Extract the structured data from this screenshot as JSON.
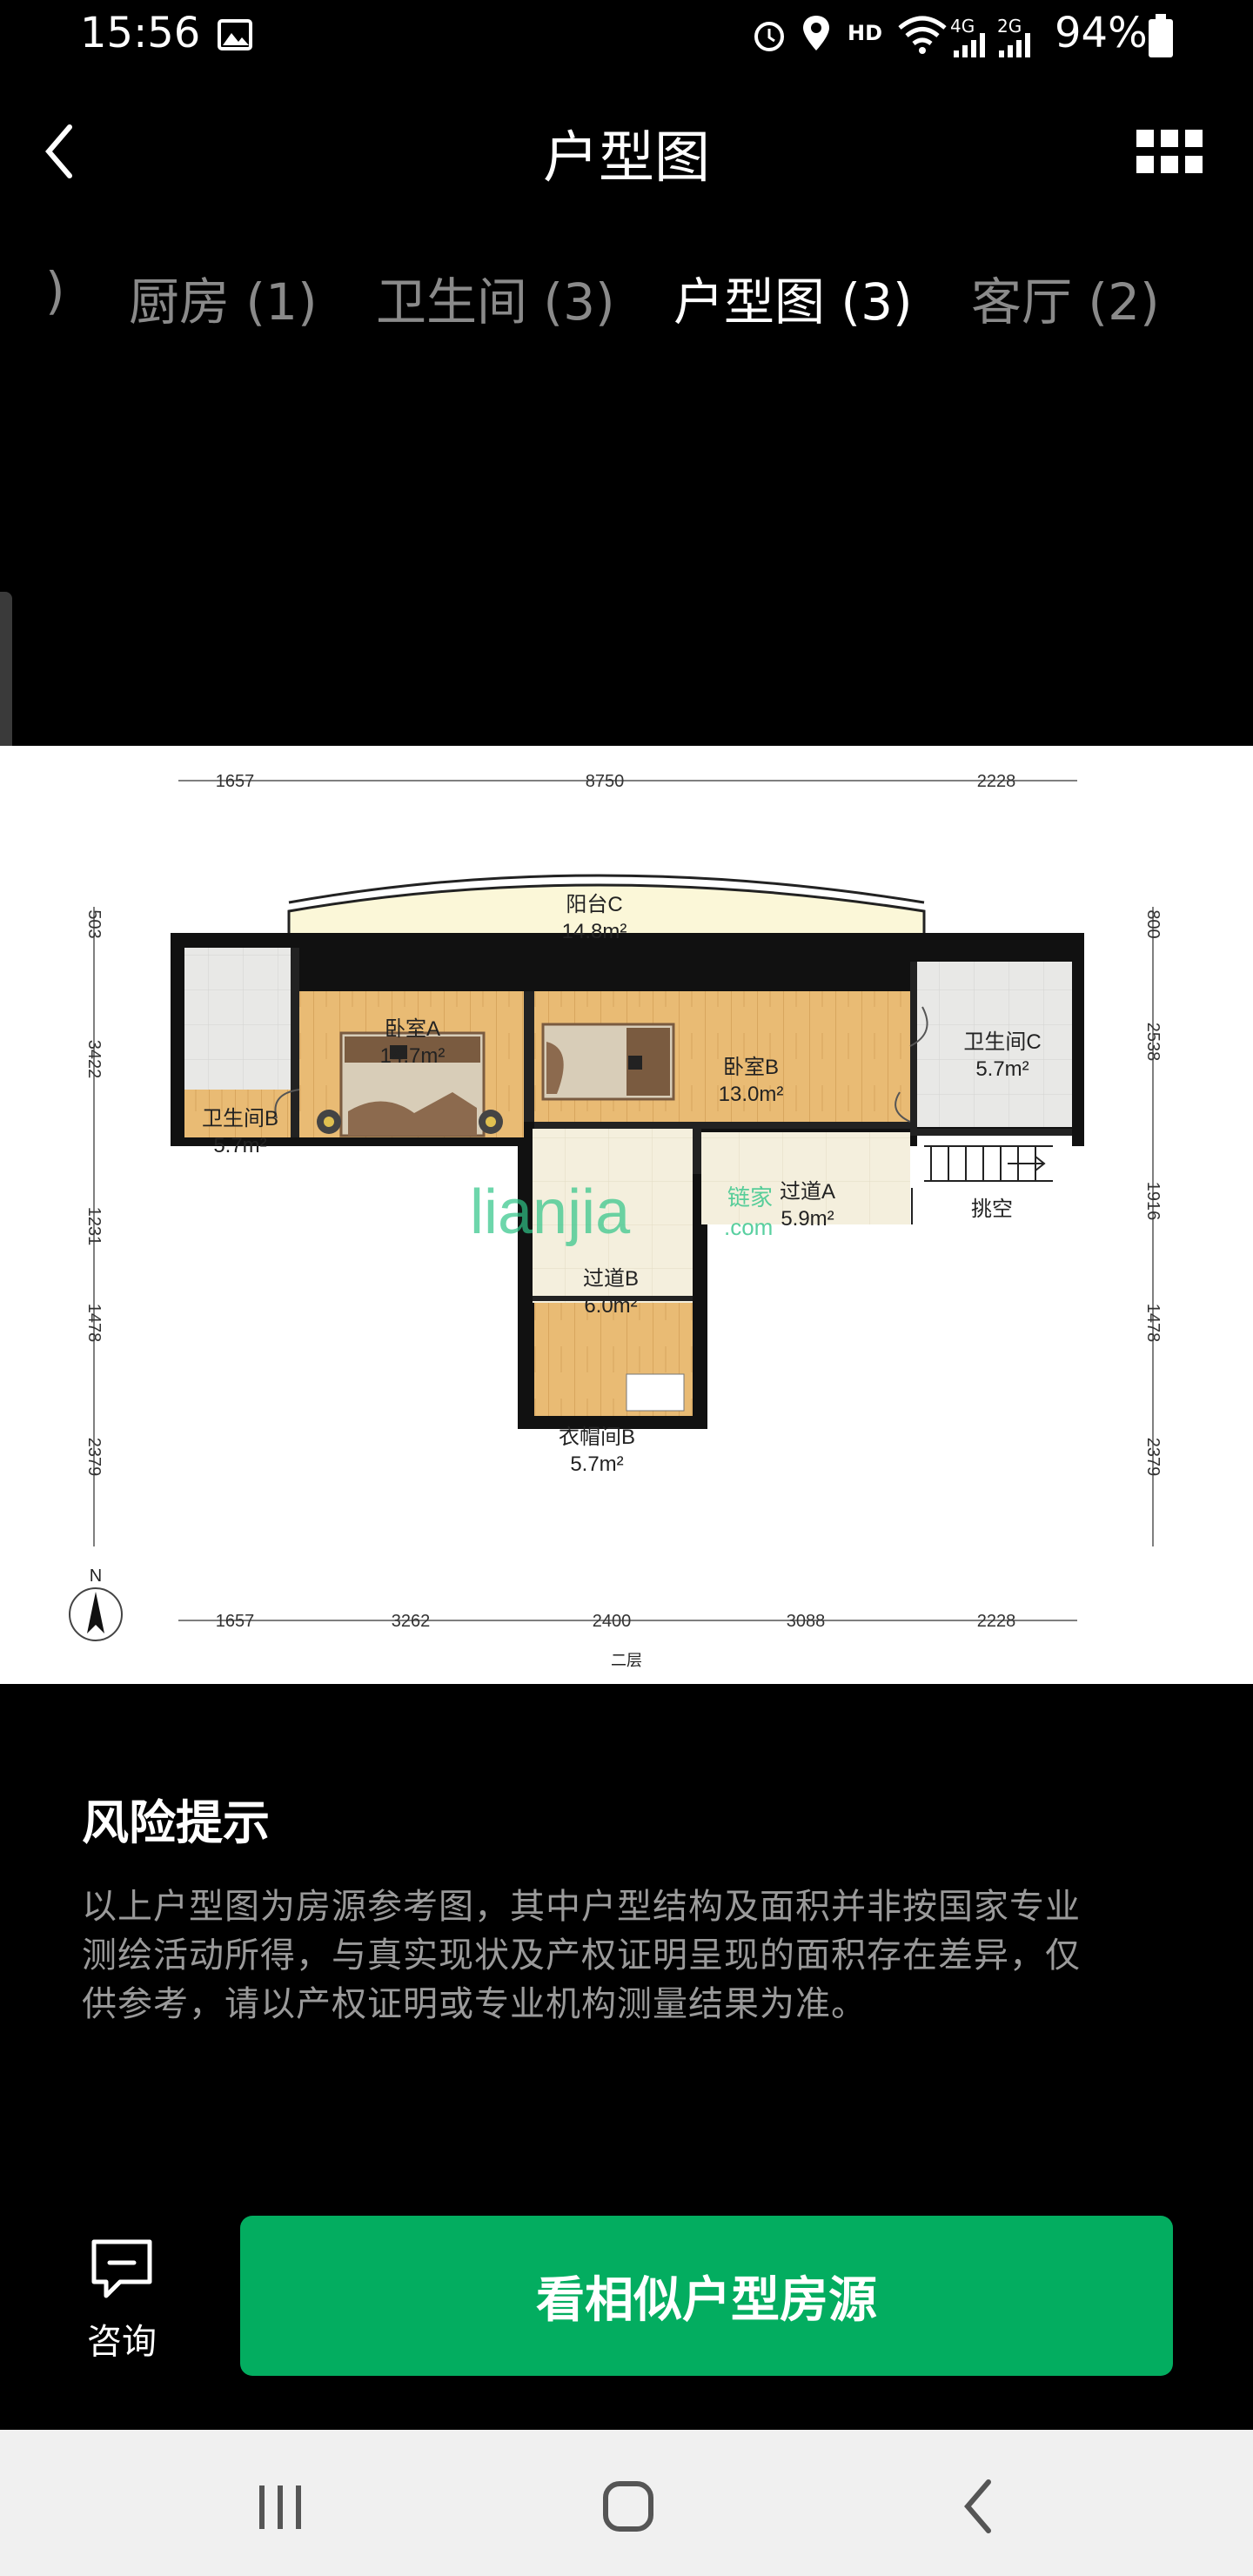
{
  "status_bar": {
    "time": "15:56",
    "network_hd": "HD",
    "network_4g": "4G",
    "network_2g": "2G",
    "battery": "94%"
  },
  "header": {
    "title": "户型图",
    "back_icon": "chevron-left-icon",
    "grid_icon": "grid-icon"
  },
  "tabs": [
    {
      "label": ")",
      "active": false
    },
    {
      "label": "厨房 (1)",
      "active": false
    },
    {
      "label": "卫生间 (3)",
      "active": false
    },
    {
      "label": "户型图 (3)",
      "active": true
    },
    {
      "label": "客厅 (2)",
      "active": false
    }
  ],
  "floorplan": {
    "top_dimensions": [
      "1657",
      "8750",
      "2228"
    ],
    "bottom_dimensions": [
      "1657",
      "3262",
      "2400",
      "3088",
      "2228"
    ],
    "left_dimensions": [
      "503",
      "3422",
      "1231",
      "1478",
      "2379"
    ],
    "right_dimensions": [
      "800",
      "2538",
      "1916",
      "1478",
      "2379"
    ],
    "rooms": [
      {
        "name": "阳台C",
        "area": "14.8m²"
      },
      {
        "name": "卧室A",
        "area": "14.7m²"
      },
      {
        "name": "卧室B",
        "area": "13.0m²"
      },
      {
        "name": "卫生间C",
        "area": "5.7m²"
      },
      {
        "name": "卫生间B",
        "area": "5.7m²"
      },
      {
        "name": "过道A",
        "area": "5.9m²"
      },
      {
        "name": "挑空",
        "area": ""
      },
      {
        "name": "过道B",
        "area": "6.0m²"
      },
      {
        "name": "衣帽间B",
        "area": "5.7m²"
      }
    ],
    "floor_label": "二层",
    "compass_label": "N",
    "watermark_main": "lianjia",
    "watermark_cn": "链家",
    "watermark_com": ".com"
  },
  "risk": {
    "title": "风险提示",
    "text_line1": "以上户型图为房源参考图，其中户型结构及面积并非按国家专业",
    "text_line2": "测绘活动所得，与真实现状及产权证明呈现的面积存在差异，仅",
    "text_line3": "供参考，请以产权证明或专业机构测量结果为准。"
  },
  "actions": {
    "consult_label": "咨询",
    "similar_label": "看相似户型房源",
    "accent": "#03ad60"
  }
}
